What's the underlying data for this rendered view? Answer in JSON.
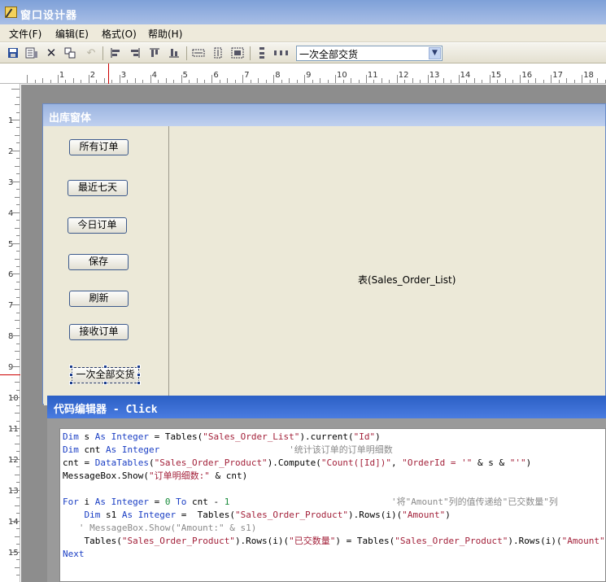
{
  "app": {
    "title": "窗口设计器"
  },
  "menu": [
    {
      "label": "文件(F)"
    },
    {
      "label": "编辑(E)"
    },
    {
      "label": "格式(O)"
    },
    {
      "label": "帮助(H)"
    }
  ],
  "toolbar": {
    "icons": [
      "save-icon",
      "properties-icon",
      "delete-icon",
      "copy-icon",
      "undo-icon",
      "align-left-icon",
      "align-right-icon",
      "align-top-icon",
      "align-bottom-icon",
      "same-width-icon",
      "same-height-icon",
      "same-size-icon",
      "vertical-spacing-icon",
      "horizontal-spacing-icon"
    ],
    "combo_value": "一次全部交货"
  },
  "ruler": {
    "h_labels": [
      "1",
      "2",
      "3",
      "4",
      "5",
      "6",
      "7",
      "8",
      "9",
      "10",
      "11",
      "12",
      "13",
      "14",
      "15",
      "16",
      "17",
      "18"
    ],
    "v_labels": [
      "1",
      "2",
      "3",
      "4",
      "5",
      "6",
      "7",
      "8",
      "9",
      "10",
      "11",
      "12",
      "13",
      "14",
      "15"
    ]
  },
  "form": {
    "title": "出库窗体",
    "buttons": [
      {
        "label": "所有订单"
      },
      {
        "label": "最近七天"
      },
      {
        "label": "今日订单"
      },
      {
        "label": "保存"
      },
      {
        "label": "刷新"
      },
      {
        "label": "接收订单"
      },
      {
        "label": "一次全部交货"
      }
    ],
    "table_label": "表(Sales_Order_List)"
  },
  "editor": {
    "title": "代码编辑器 - Click",
    "lines": [
      [
        [
          "kw",
          "Dim"
        ],
        [
          "pl",
          " s "
        ],
        [
          "kw",
          "As Integer"
        ],
        [
          "pl",
          " = Tables("
        ],
        [
          "st",
          "\"Sales_Order_List\""
        ],
        [
          "pl",
          ").current("
        ],
        [
          "st",
          "\"Id\""
        ],
        [
          "pl",
          ")"
        ]
      ],
      [
        [
          "kw",
          "Dim"
        ],
        [
          "pl",
          " cnt "
        ],
        [
          "kw",
          "As Integer"
        ],
        [
          "pl",
          "                        "
        ],
        [
          "cm",
          "'统计该订单的订单明细数"
        ]
      ],
      [
        [
          "pl",
          "cnt = "
        ],
        [
          "kw",
          "DataTables"
        ],
        [
          "pl",
          "("
        ],
        [
          "st",
          "\"Sales_Order_Product\""
        ],
        [
          "pl",
          ").Compute("
        ],
        [
          "st",
          "\"Count([Id])\""
        ],
        [
          "pl",
          ", "
        ],
        [
          "st",
          "\"OrderId = '\""
        ],
        [
          "pl",
          " & s & "
        ],
        [
          "st",
          "\"'\""
        ],
        [
          "pl",
          ")"
        ]
      ],
      [
        [
          "pl",
          "MessageBox.Show("
        ],
        [
          "st",
          "\"订单明细数:\""
        ],
        [
          "pl",
          " & cnt)"
        ]
      ],
      [
        [
          "pl",
          ""
        ]
      ],
      [
        [
          "kw",
          "For"
        ],
        [
          "pl",
          " i "
        ],
        [
          "kw",
          "As Integer"
        ],
        [
          "pl",
          " = "
        ],
        [
          "num",
          "0"
        ],
        [
          "pl",
          " "
        ],
        [
          "kw",
          "To"
        ],
        [
          "pl",
          " cnt - "
        ],
        [
          "num",
          "1"
        ],
        [
          "pl",
          "                              "
        ],
        [
          "cm",
          "'将\"Amount\"列的值传递给\"已交数量\"列"
        ]
      ],
      [
        [
          "pl",
          "    "
        ],
        [
          "kw",
          "Dim"
        ],
        [
          "pl",
          " s1 "
        ],
        [
          "kw",
          "As Integer"
        ],
        [
          "pl",
          " =  Tables("
        ],
        [
          "st",
          "\"Sales_Order_Product\""
        ],
        [
          "pl",
          ").Rows(i)("
        ],
        [
          "st",
          "\"Amount\""
        ],
        [
          "pl",
          ")"
        ]
      ],
      [
        [
          "cm",
          "   ' MessageBox.Show(\"Amount:\" & s1)"
        ]
      ],
      [
        [
          "pl",
          "    Tables("
        ],
        [
          "st",
          "\"Sales_Order_Product\""
        ],
        [
          "pl",
          ").Rows(i)("
        ],
        [
          "st",
          "\"已交数量\""
        ],
        [
          "pl",
          ") = Tables("
        ],
        [
          "st",
          "\"Sales_Order_Product\""
        ],
        [
          "pl",
          ").Rows(i)("
        ],
        [
          "st",
          "\"Amount\""
        ],
        [
          "pl",
          ")"
        ]
      ],
      [
        [
          "kw",
          "Next"
        ]
      ]
    ]
  }
}
